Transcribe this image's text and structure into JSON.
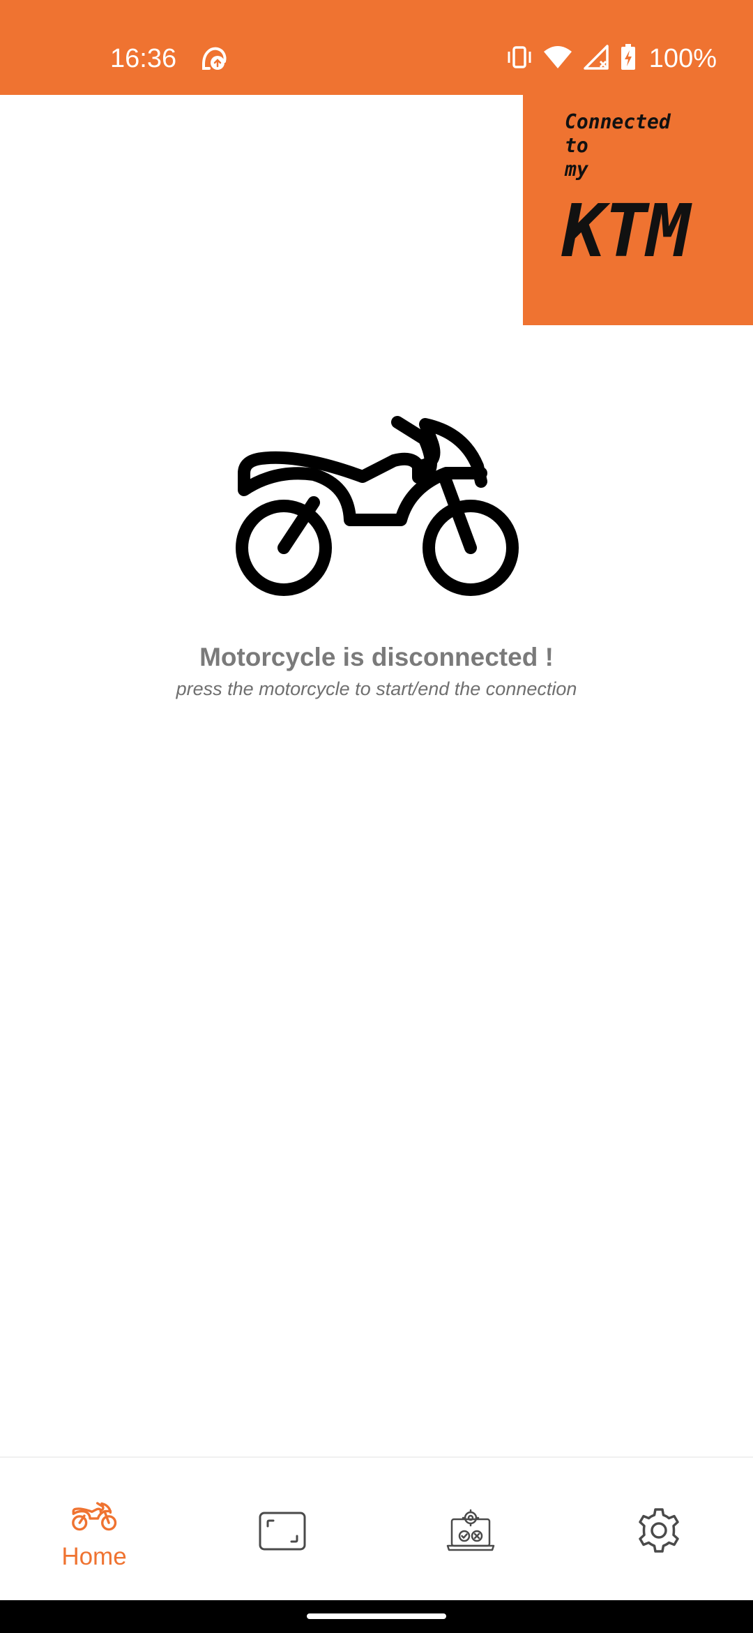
{
  "colors": {
    "accent": "#ef7331",
    "text_dark": "#111111",
    "text_gray": "#7a7a7a",
    "nav_icon_gray": "#4a4a4a"
  },
  "status_bar": {
    "time": "16:36",
    "battery": "100%",
    "icons": [
      "app-sync-icon",
      "vibrate-icon",
      "wifi-icon",
      "signal-icon",
      "battery-charging-icon"
    ]
  },
  "logo": {
    "line1": "Connected",
    "line2": "to",
    "line3": "my",
    "brand": "KTM"
  },
  "connection": {
    "icon": "motorcycle-icon",
    "title": "Motorcycle is disconnected !",
    "hint": "press the motorcycle to start/end the connection"
  },
  "bottom_nav": {
    "items": [
      {
        "icon": "motorcycle-icon",
        "label": "Home",
        "active": true
      },
      {
        "icon": "frame-icon",
        "label": "",
        "active": false
      },
      {
        "icon": "diagnostics-icon",
        "label": "",
        "active": false
      },
      {
        "icon": "gear-icon",
        "label": "",
        "active": false
      }
    ]
  }
}
